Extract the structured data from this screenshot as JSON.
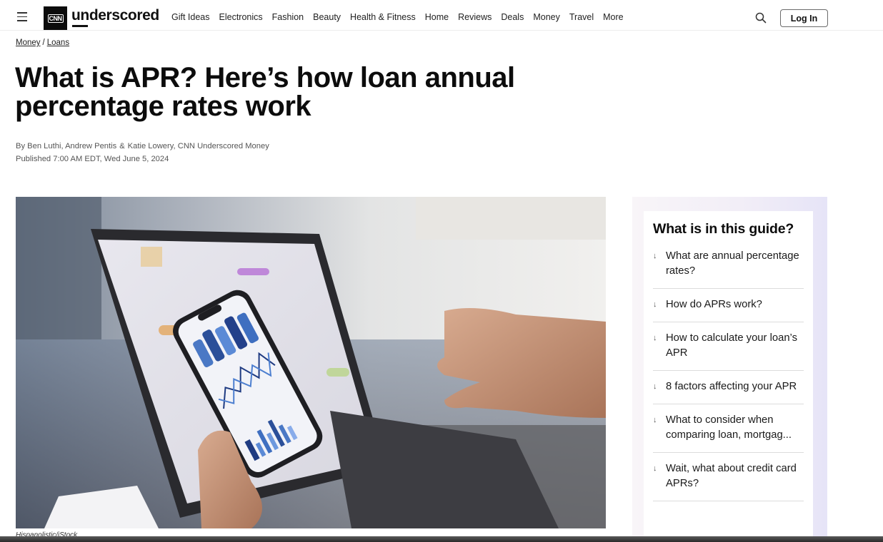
{
  "header": {
    "logo": {
      "brand_box": "CNN",
      "wordmark": "underscored"
    },
    "nav": [
      "Gift Ideas",
      "Electronics",
      "Fashion",
      "Beauty",
      "Health & Fitness",
      "Home",
      "Reviews",
      "Deals",
      "Money",
      "Travel",
      "More"
    ],
    "icons": {
      "menu": "hamburger-icon",
      "search": "search-icon"
    },
    "login_label": "Log In"
  },
  "breadcrumb": {
    "items": [
      "Money",
      "Loans"
    ],
    "separator": "/"
  },
  "article": {
    "title": "What is APR? Here’s how loan annual percentage rates work",
    "byline": {
      "prefix": "By",
      "authors": [
        "Ben Luthi,",
        "Andrew Pentis",
        "Katie Lowery,"
      ],
      "amp": "&",
      "publication": "CNN Underscored Money"
    },
    "published": "Published 7:00 AM EDT, Wed June 5, 2024",
    "hero_image": {
      "alt": "Person holding smartphone showing financial charts while typing on a laptop",
      "caption": "Hispanolistic/iStock"
    }
  },
  "toc": {
    "heading": "What is in this guide?",
    "arrow": "↓",
    "items": [
      "What are annual percentage rates?",
      "How do APRs work?",
      "How to calculate your loan’s APR",
      "8 factors affecting your APR",
      "What to consider when comparing loan, mortgag...",
      "Wait, what about credit card APRs?"
    ]
  },
  "colors": {
    "text": "#0c0c0c",
    "sidebar_gradient_start": "#f8f5f8",
    "sidebar_gradient_end": "#e6e4f7",
    "divider": "#dcdcdc"
  }
}
